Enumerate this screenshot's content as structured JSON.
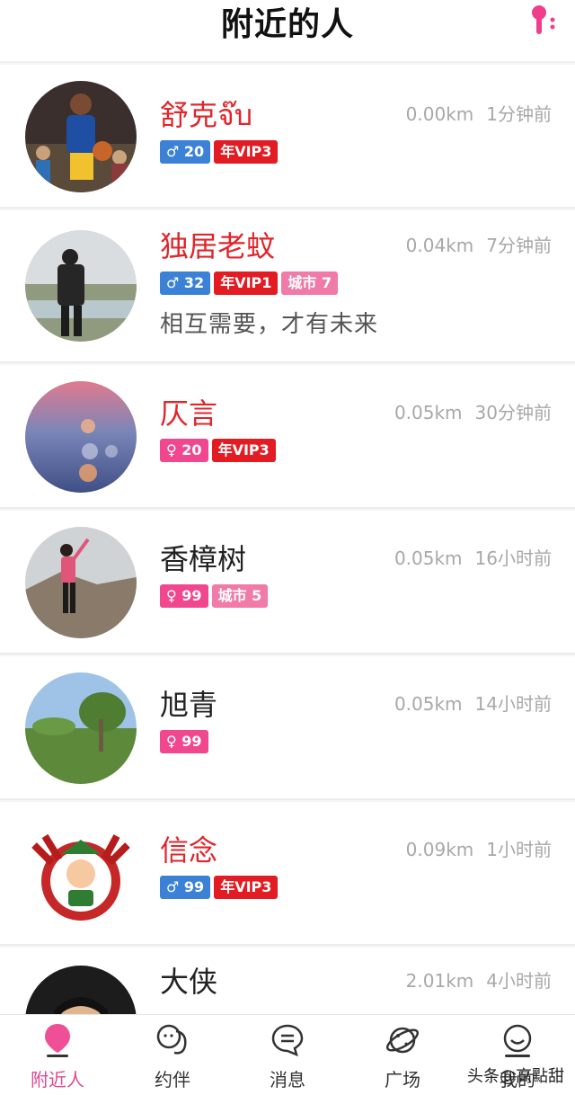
{
  "header": {
    "title": "附近的人",
    "filter_icon": "filter-icon"
  },
  "colors": {
    "accent": "#e1488f",
    "vip_name": "#e0252b",
    "male_tag": "#3b82d6",
    "female_tag": "#f0478f",
    "vip_tag": "#e31b23",
    "city_tag": "#f07aa8"
  },
  "users": [
    {
      "name": "舒克จ๊บ",
      "distance": "0.00km",
      "time": "1分钟前",
      "gender": "♂ 20",
      "vip": "年VIP3",
      "city": "",
      "signature": ""
    },
    {
      "name": "独居老蚊",
      "distance": "0.04km",
      "time": "7分钟前",
      "gender": "♂ 32",
      "vip": "年VIP1",
      "city": "城市 7",
      "signature": "相互需要，才有未来"
    },
    {
      "name": "仄言",
      "distance": "0.05km",
      "time": "30分钟前",
      "gender": "♀ 20",
      "vip": "年VIP3",
      "city": "",
      "signature": ""
    },
    {
      "name": "香樟树",
      "distance": "0.05km",
      "time": "16小时前",
      "gender": "♀ 99",
      "vip": "",
      "city": "城市 5",
      "signature": ""
    },
    {
      "name": "旭青",
      "distance": "0.05km",
      "time": "14小时前",
      "gender": "♀ 99",
      "vip": "",
      "city": "",
      "signature": ""
    },
    {
      "name": "信念",
      "distance": "0.09km",
      "time": "1小时前",
      "gender": "♂ 99",
      "vip": "年VIP3",
      "city": "",
      "signature": ""
    },
    {
      "name": "大侠",
      "distance": "2.01km",
      "time": "4小时前",
      "gender": "",
      "vip": "",
      "city": "",
      "signature": ""
    }
  ],
  "tabs": [
    {
      "label": "附近人",
      "icon": "location-pin-icon"
    },
    {
      "label": "约伴",
      "icon": "companions-icon"
    },
    {
      "label": "消息",
      "icon": "chat-bubble-icon"
    },
    {
      "label": "广场",
      "icon": "planet-icon"
    },
    {
      "label": "我的",
      "icon": "smiley-icon"
    }
  ],
  "watermark": "头条@高點甜"
}
